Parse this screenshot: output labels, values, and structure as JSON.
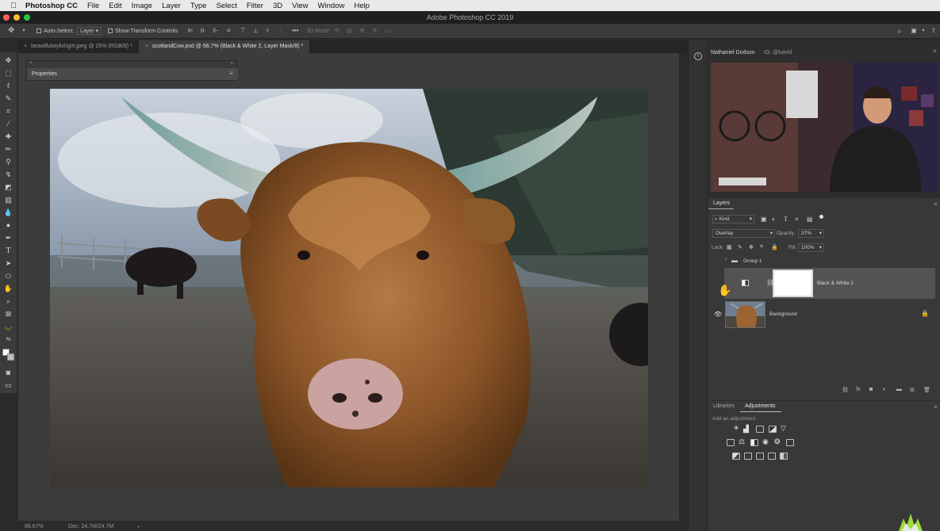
{
  "menubar": {
    "app_name": "Photoshop CC",
    "items": [
      "File",
      "Edit",
      "Image",
      "Layer",
      "Type",
      "Select",
      "Filter",
      "3D",
      "View",
      "Window",
      "Help"
    ]
  },
  "window": {
    "title": "Adobe Photoshop CC 2019"
  },
  "options_bar": {
    "auto_select_label": "Auto-Select:",
    "auto_select_value": "Layer",
    "show_transform_label": "Show Transform Controls",
    "mode_3d_label": "3D Mode:"
  },
  "doc_tabs": [
    {
      "label": "beautifulstylishgirl.jpeg @ 25% (RGB/8) *",
      "active": false
    },
    {
      "label": "scotlandCow.psd @ 66.7% (Black & White 2, Layer Mask/8) *",
      "active": true
    }
  ],
  "properties_panel": {
    "title": "Properties"
  },
  "status_bar": {
    "zoom": "66.67%",
    "doc_info": "Doc: 24.7M/24.7M"
  },
  "webcam": {
    "name": "Nathaniel Dodson",
    "handle": "IG: @tutvid"
  },
  "layers_panel": {
    "tab_label": "Layers",
    "filter_kind": "Kind",
    "blend_mode": "Overlay",
    "opacity_label": "Opacity:",
    "opacity_value": "37%",
    "lock_label": "Lock:",
    "fill_label": "Fill:",
    "fill_value": "100%",
    "layers": [
      {
        "name": "Group 1",
        "type": "group",
        "visible": false
      },
      {
        "name": "Black & White 2",
        "type": "adjustment",
        "visible": false
      },
      {
        "name": "Background",
        "type": "image",
        "visible": true,
        "locked": true
      }
    ]
  },
  "adjustments_panel": {
    "tabs": [
      "Libraries",
      "Adjustments"
    ],
    "active_tab": "Adjustments",
    "hint": "Add an adjustment"
  },
  "colors": {
    "accent_yellow": "#f2c230",
    "traffic_red": "#ff5f57",
    "traffic_yellow": "#febc2e",
    "traffic_green": "#28c840"
  }
}
